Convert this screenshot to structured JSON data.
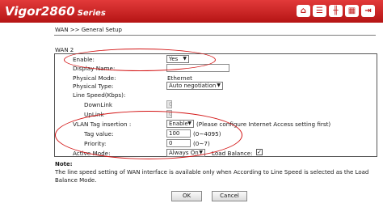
{
  "header": {
    "model": "Vigor2860",
    "series": "Series",
    "toolbar_icons": [
      "home-icon",
      "list-icon",
      "tools-icon",
      "status-icon",
      "logout-icon"
    ]
  },
  "breadcrumb": "WAN >> General Setup",
  "group_title": "WAN 2",
  "form": {
    "enable": {
      "label": "Enable:",
      "value": "Yes"
    },
    "display_name": {
      "label": "Display Name:",
      "value": ""
    },
    "physical_mode": {
      "label": "Physical Mode:",
      "value": "Ethernet"
    },
    "physical_type": {
      "label": "Physical Type:",
      "value": "Auto negotiation"
    },
    "line_speed": {
      "label": "Line Speed(Kbps):",
      "downlink": {
        "label": "DownLink",
        "value": "0"
      },
      "uplink": {
        "label": "UpLink",
        "value": "0"
      }
    },
    "vlan": {
      "label": "VLAN Tag insertion :",
      "value": "Enable",
      "hint": "(Please configure Internet Access setting first)"
    },
    "tag_value": {
      "label": "Tag value:",
      "value": "100",
      "range": "(0~4095)"
    },
    "priority": {
      "label": "Priority:",
      "value": "0",
      "range": "(0~7)"
    },
    "active_mode": {
      "label": "Active Mode:",
      "value": "Always On"
    },
    "load_balance": {
      "label": "Load Balance:",
      "checked": true,
      "mark": "✓"
    }
  },
  "note": {
    "title": "Note:",
    "text": "The line speed setting of WAN interface is available only when According to Line Speed is selected as the Load Balance Mode."
  },
  "buttons": {
    "ok": "OK",
    "cancel": "Cancel"
  },
  "colors": {
    "header": "#c81e1e",
    "highlight_ring": "#d31414"
  }
}
